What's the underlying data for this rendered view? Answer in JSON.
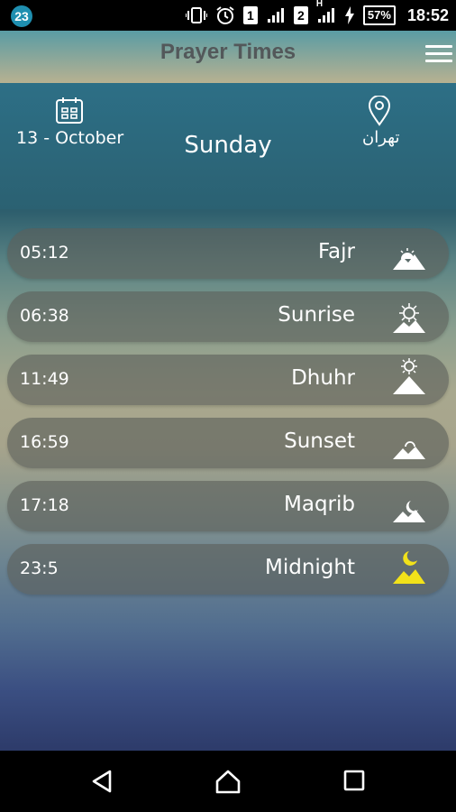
{
  "status_bar": {
    "notification_count": "23",
    "sim1": "1",
    "sim2": "2",
    "network_type": "H",
    "battery": "57%",
    "time": "18:52"
  },
  "app_bar": {
    "title": "Prayer Times"
  },
  "header": {
    "date": "13 - October",
    "day": "Sunday",
    "city": "تهران"
  },
  "prayers": [
    {
      "time": "05:12",
      "name": "Fajr",
      "icon": "sun-rising-over-mountain-icon"
    },
    {
      "time": "06:38",
      "name": "Sunrise",
      "icon": "sun-over-mountain-icon"
    },
    {
      "time": "11:49",
      "name": "Dhuhr",
      "icon": "sun-high-over-mountain-icon"
    },
    {
      "time": "16:59",
      "name": "Sunset",
      "icon": "sun-setting-mountain-icon"
    },
    {
      "time": "17:18",
      "name": "Maqrib",
      "icon": "moon-over-mountain-icon"
    },
    {
      "time": "23:5",
      "name": "Midnight",
      "icon": "crescent-moon-mountain-icon"
    }
  ],
  "colors": {
    "midnight_icon": "#f2e21a",
    "row_background": "#5c605a"
  }
}
